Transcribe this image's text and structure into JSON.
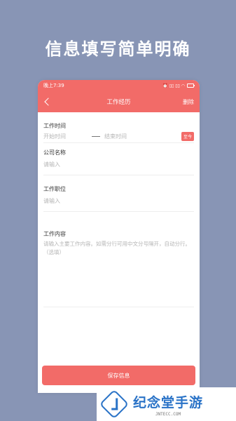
{
  "headline": "信息填写简单明确",
  "statusbar": {
    "time": "晚上7:39",
    "icons_text": "⏰ ▯▯ ▯▯ ◠",
    "battery_level": ""
  },
  "navbar": {
    "title": "工作经历",
    "delete_label": "删除"
  },
  "form": {
    "work_time": {
      "label": "工作时间",
      "start_placeholder": "开始时间",
      "end_placeholder": "结束时间",
      "present_label": "至今"
    },
    "company": {
      "label": "公司名称",
      "placeholder": "请输入"
    },
    "position": {
      "label": "工作职位",
      "placeholder": "请输入"
    },
    "content": {
      "label": "工作内容",
      "placeholder": "请输入主要工作内容。如需分行可用中文分号隔开，自动分行。（选填）"
    }
  },
  "save_button": "保存信息",
  "watermark": {
    "name": "纪念堂手游",
    "url": "JNTECC.COM"
  },
  "colors": {
    "accent": "#f26b68",
    "background": "#8895b5",
    "watermark": "#2a73c7"
  }
}
